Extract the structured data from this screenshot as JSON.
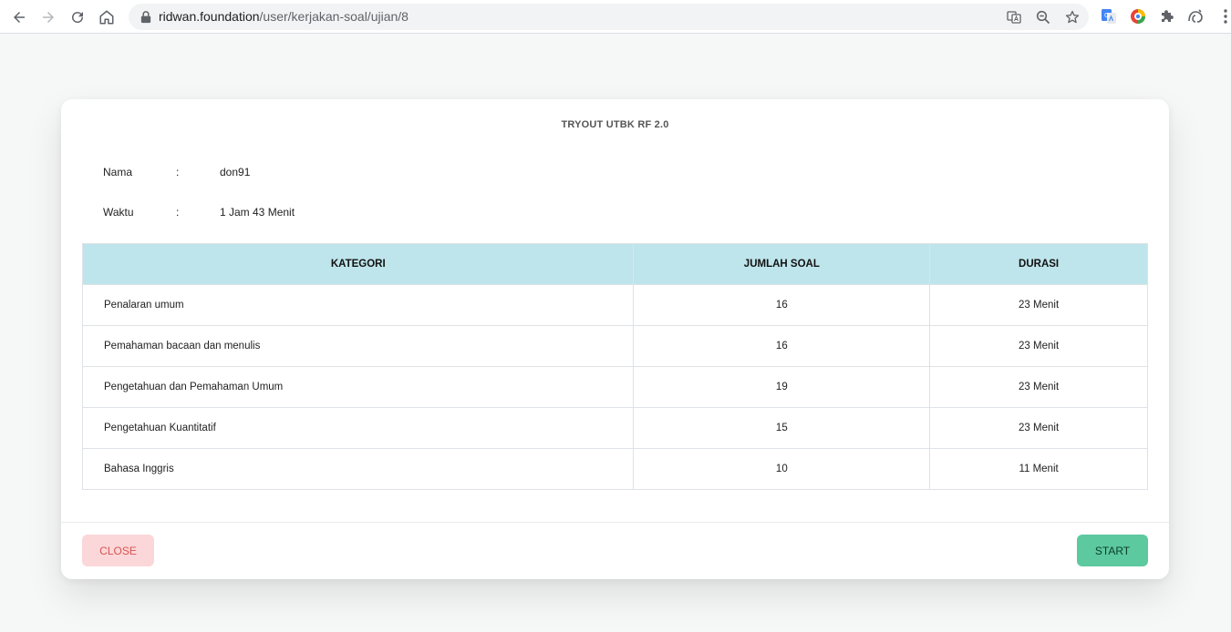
{
  "browser": {
    "url_host": "ridwan.foundation",
    "url_path": "/user/kerjakan-soal/ujian/8"
  },
  "modal": {
    "title": "TRYOUT UTBK RF 2.0",
    "info": [
      {
        "label": "Nama",
        "colon": ":",
        "value": "don91"
      },
      {
        "label": "Waktu",
        "colon": ":",
        "value": "1 Jam 43 Menit"
      }
    ],
    "table": {
      "headers": [
        "KATEGORI",
        "JUMLAH SOAL",
        "DURASI"
      ],
      "rows": [
        {
          "kategori": "Penalaran umum",
          "jumlah": "16",
          "durasi": "23 Menit"
        },
        {
          "kategori": "Pemahaman bacaan dan menulis",
          "jumlah": "16",
          "durasi": "23 Menit"
        },
        {
          "kategori": "Pengetahuan dan Pemahaman Umum",
          "jumlah": "19",
          "durasi": "23 Menit"
        },
        {
          "kategori": "Pengetahuan Kuantitatif",
          "jumlah": "15",
          "durasi": "23 Menit"
        },
        {
          "kategori": "Bahasa Inggris",
          "jumlah": "10",
          "durasi": "11 Menit"
        }
      ]
    },
    "close_label": "CLOSE",
    "start_label": "START"
  },
  "colors": {
    "table_header_bg": "#bee5eb",
    "close_bg": "#fbd7d9",
    "close_text": "#d9534f",
    "start_bg": "#5cc99f"
  },
  "icons": [
    "back-arrow-icon",
    "forward-arrow-icon",
    "reload-icon",
    "home-icon",
    "lock-icon",
    "translate-icon",
    "zoom-out-icon",
    "star-icon",
    "google-translate-extension-icon",
    "color-extension-icon",
    "extensions-puzzle-icon",
    "profile-extension-icon",
    "kebab-menu-icon"
  ]
}
